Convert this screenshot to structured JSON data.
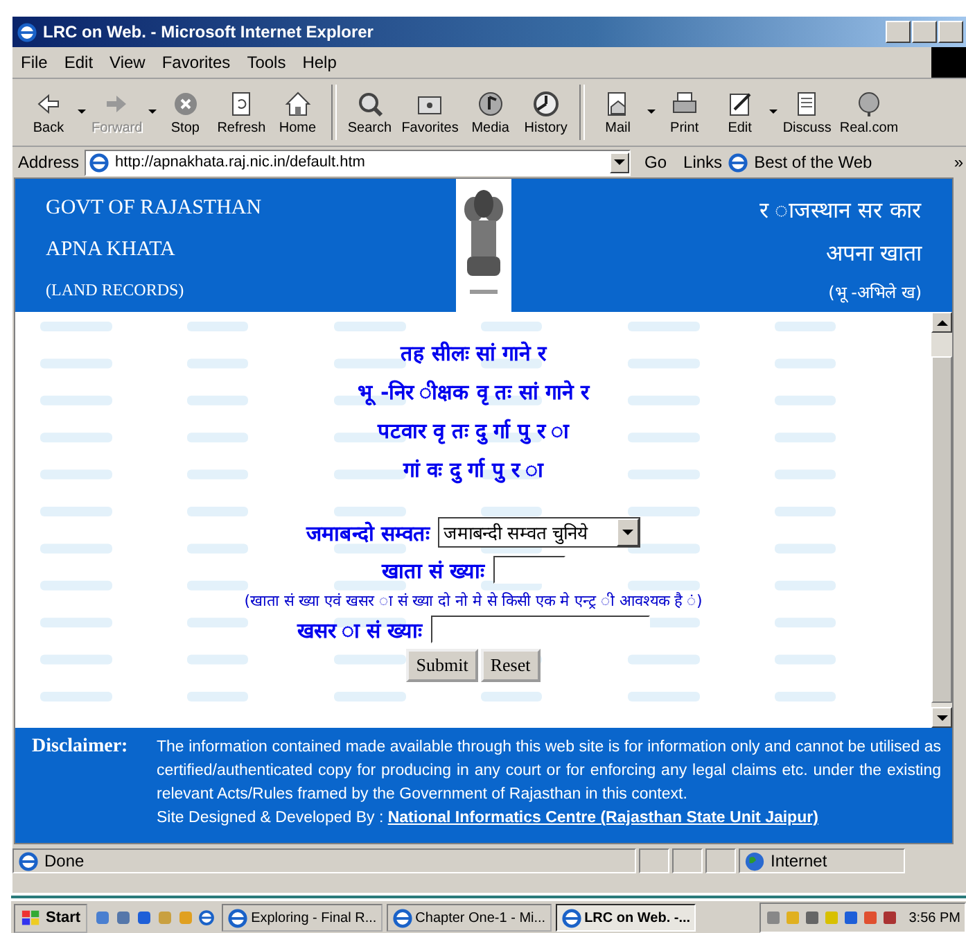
{
  "window": {
    "title": "LRC on Web. - Microsoft Internet Explorer"
  },
  "menu": [
    "File",
    "Edit",
    "View",
    "Favorites",
    "Tools",
    "Help"
  ],
  "toolbar": [
    {
      "label": "Back",
      "disabled": false,
      "dropdown": true
    },
    {
      "label": "Forward",
      "disabled": true,
      "dropdown": true
    },
    {
      "label": "Stop",
      "disabled": false,
      "dropdown": false
    },
    {
      "label": "Refresh",
      "disabled": false,
      "dropdown": false
    },
    {
      "label": "Home",
      "disabled": false,
      "dropdown": false
    },
    {
      "label": "Search",
      "disabled": false,
      "dropdown": false
    },
    {
      "label": "Favorites",
      "disabled": false,
      "dropdown": false
    },
    {
      "label": "Media",
      "disabled": false,
      "dropdown": false
    },
    {
      "label": "History",
      "disabled": false,
      "dropdown": false
    },
    {
      "label": "Mail",
      "disabled": false,
      "dropdown": true
    },
    {
      "label": "Print",
      "disabled": false,
      "dropdown": false
    },
    {
      "label": "Edit",
      "disabled": false,
      "dropdown": true
    },
    {
      "label": "Discuss",
      "disabled": false,
      "dropdown": false
    },
    {
      "label": "Real.com",
      "disabled": false,
      "dropdown": false
    }
  ],
  "address": {
    "label": "Address",
    "value": "http://apnakhata.raj.nic.in/default.htm",
    "go": "Go",
    "links": "Links",
    "link_item": "Best of the Web",
    "more": "»"
  },
  "page": {
    "header": {
      "left": [
        "GOVT OF RAJASTHAN",
        "APNA KHATA",
        "(LAND RECORDS)"
      ],
      "right": [
        "र ाजस्थान सर कार",
        "अपना खाता",
        "(भू -अभिले ख)"
      ]
    },
    "info_lines": [
      "तह सीलः सां गाने र",
      "भू -निर ीक्षक वृ तः सां गाने र",
      "पटवार  वृ तः दु र्गा पु र ा",
      "गां वः दु र्गा पु र ा"
    ],
    "form": {
      "samvat_label": "जमाबन्दो सम्वतः",
      "samvat_value": "जमाबन्दी सम्वत चुनिये",
      "khata_label": "खाता सं ख्याः",
      "note": "(खाता सं ख्या एवं  खसर ा सं ख्या दो नो  मे  से  किसी एक मे  एन्ट्र ी आवश्यक है ं)",
      "khasra_label": "खसर ा सं ख्याः",
      "submit": "Submit",
      "reset": "Reset"
    },
    "disclaimer": {
      "label": "Disclaimer:",
      "text": "The information contained  made available  through  this web site is for information only  and cannot be utilised as certified/authenticated copy for producing in any court or for enforcing any legal claims etc. under the existing relevant Acts/Rules framed by the Government of Rajasthan in this context.",
      "credit": "Site  Designed & Developed  By :",
      "credit_link": "National Informatics Centre (Rajasthan State Unit  Jaipur)"
    }
  },
  "status_bar": {
    "text": "Done",
    "zone": "Internet"
  },
  "taskbar": {
    "start": "Start",
    "tasks": [
      {
        "label": "Exploring - Final R...",
        "selected": false
      },
      {
        "label": "Chapter One-1 - Mi...",
        "selected": false
      },
      {
        "label": "LRC on Web. -...",
        "selected": true
      }
    ],
    "clock": "3:56 PM"
  }
}
